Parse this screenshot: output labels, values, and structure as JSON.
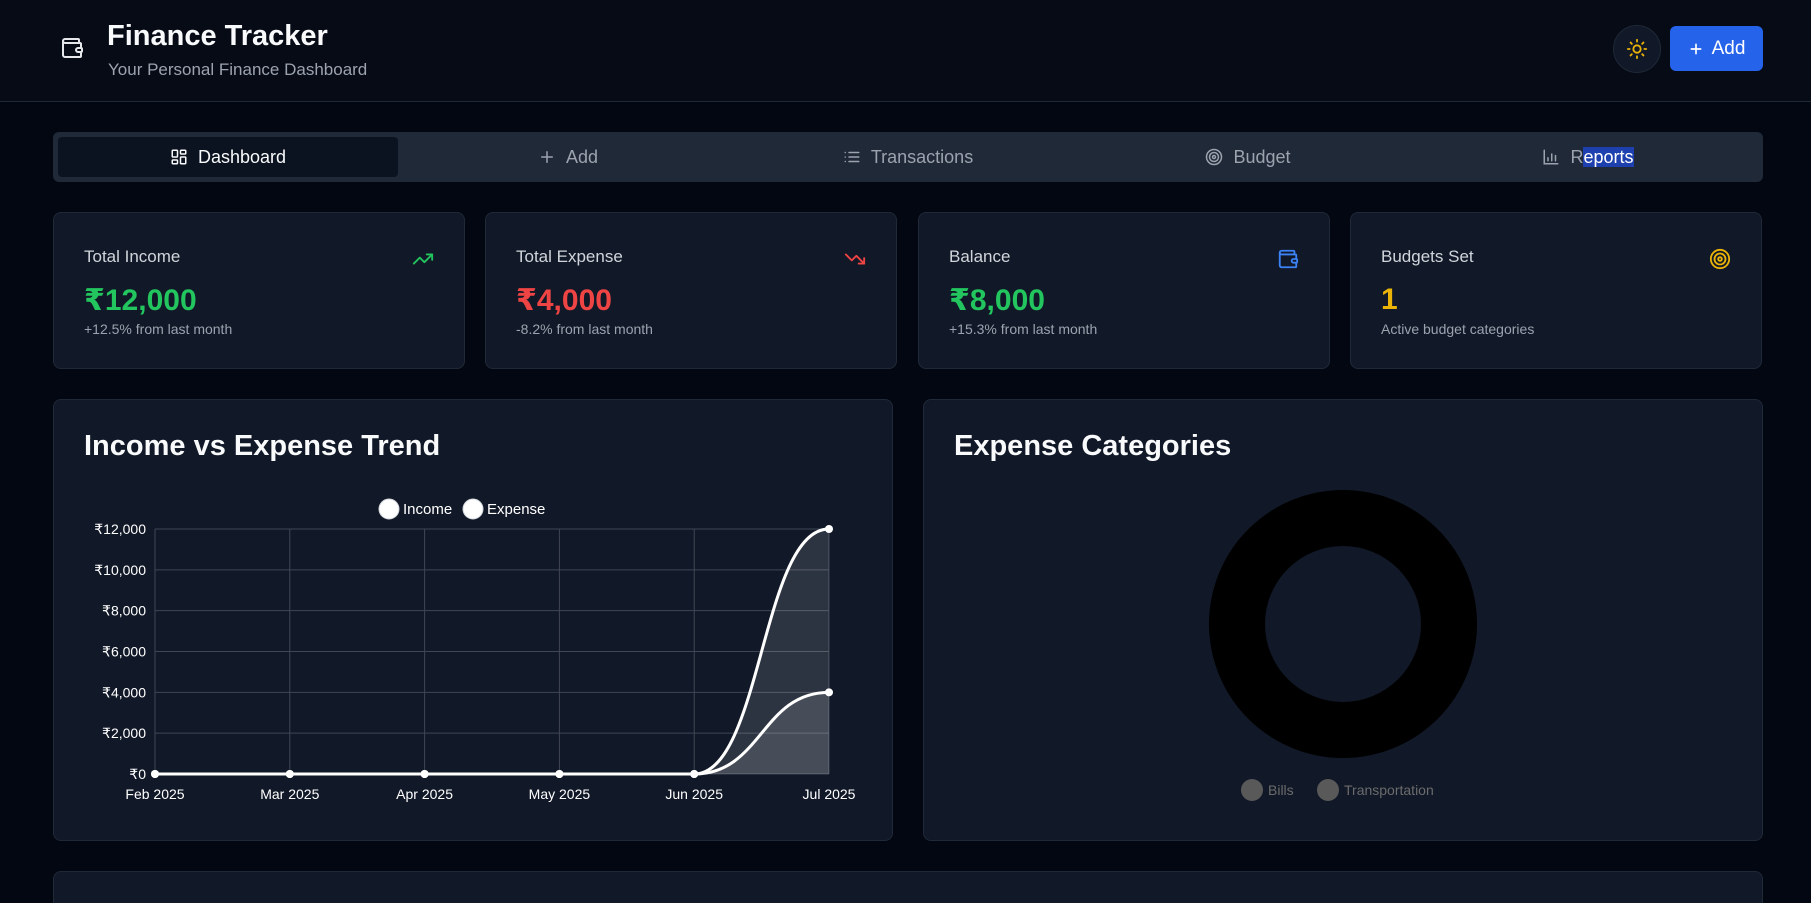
{
  "header": {
    "title": "Finance Tracker",
    "subtitle": "Your Personal Finance Dashboard",
    "logo_icon": "wallet-icon",
    "theme_icon": "sun-icon",
    "add_label": "Add"
  },
  "tabs": [
    {
      "label": "Dashboard",
      "icon": "dashboard-grid-icon",
      "active": true
    },
    {
      "label": "Add",
      "icon": "plus-icon",
      "active": false
    },
    {
      "label": "Transactions",
      "icon": "list-icon",
      "active": false
    },
    {
      "label": "Budget",
      "icon": "target-icon",
      "active": false
    },
    {
      "label": "Reports",
      "icon": "bar-chart-icon",
      "active": false
    }
  ],
  "stats": [
    {
      "label": "Total Income",
      "value": "₹12,000",
      "sub": "+12.5% from last month",
      "icon": "trending-up-icon",
      "color": "#22c55e"
    },
    {
      "label": "Total Expense",
      "value": "₹4,000",
      "sub": "-8.2% from last month",
      "icon": "trending-down-icon",
      "color": "#ef4444"
    },
    {
      "label": "Balance",
      "value": "₹8,000",
      "sub": "+15.3% from last month",
      "icon": "wallet-icon",
      "color": "#22c55e"
    },
    {
      "label": "Budgets Set",
      "value": "1",
      "sub": "Active budget categories",
      "icon": "target-icon",
      "color": "#eab308"
    }
  ],
  "trend": {
    "title": "Income vs Expense Trend"
  },
  "categories_panel": {
    "title": "Expense Categories"
  },
  "chart_data": [
    {
      "type": "line",
      "title": "Income vs Expense Trend",
      "x": [
        "Feb 2025",
        "Mar 2025",
        "Apr 2025",
        "May 2025",
        "Jun 2025",
        "Jul 2025"
      ],
      "series": [
        {
          "name": "Income",
          "values": [
            0,
            0,
            0,
            0,
            0,
            12000
          ]
        },
        {
          "name": "Expense",
          "values": [
            0,
            0,
            0,
            0,
            0,
            4000
          ]
        }
      ],
      "yticks": [
        "₹0",
        "₹2,000",
        "₹4,000",
        "₹6,000",
        "₹8,000",
        "₹10,000",
        "₹12,000"
      ],
      "ylim": [
        0,
        12000
      ],
      "grid": true,
      "legend": "top-center"
    },
    {
      "type": "pie",
      "title": "Expense Categories",
      "labels": [
        "Bills",
        "Transportation"
      ],
      "legend": "bottom-center"
    }
  ]
}
